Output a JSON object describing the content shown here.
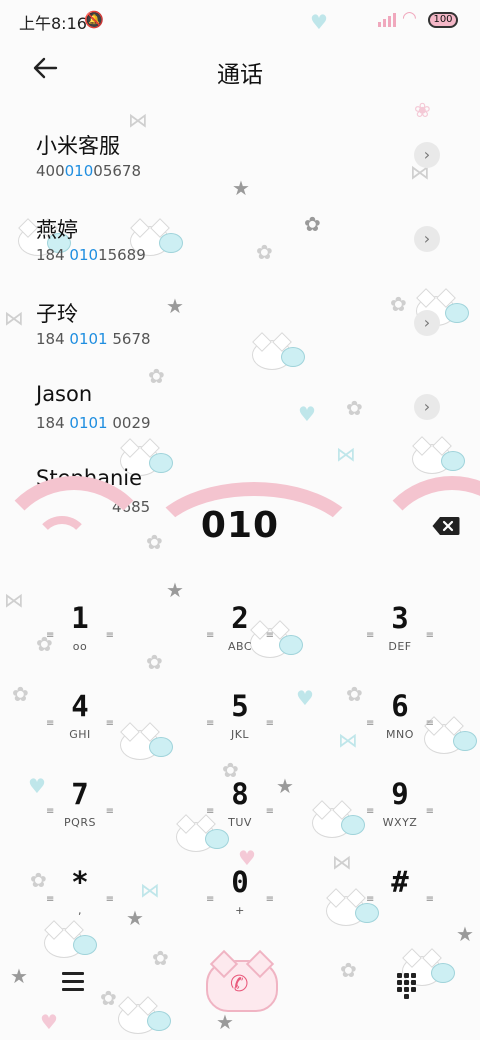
{
  "status_bar": {
    "time": "上午8:16",
    "battery": "100"
  },
  "header": {
    "title": "通话"
  },
  "contacts": [
    {
      "name": "小米客服",
      "num_pre": "400",
      "num_hl": "010",
      "num_post": "05678"
    },
    {
      "name": "燕婷",
      "num_pre": "184 ",
      "num_hl": "010",
      "num_post": "15689"
    },
    {
      "name": "子玲",
      "num_pre": "184 ",
      "num_hl": "0101",
      "num_post": " 5678"
    },
    {
      "name": "Jason",
      "num_pre": "184 ",
      "num_hl": "0101",
      "num_post": " 0029"
    },
    {
      "name": "Stephanie",
      "num_pre": "",
      "num_hl": "",
      "num_post": "4685"
    }
  ],
  "dialed_number": "010",
  "keypad": [
    {
      "digit": "1",
      "letters": "⌕"
    },
    {
      "digit": "2",
      "letters": "ABC"
    },
    {
      "digit": "3",
      "letters": "DEF"
    },
    {
      "digit": "4",
      "letters": "GHI"
    },
    {
      "digit": "5",
      "letters": "JKL"
    },
    {
      "digit": "6",
      "letters": "MNO"
    },
    {
      "digit": "7",
      "letters": "PQRS"
    },
    {
      "digit": "8",
      "letters": "TUV"
    },
    {
      "digit": "9",
      "letters": "WXYZ"
    },
    {
      "digit": "*",
      "letters": ","
    },
    {
      "digit": "0",
      "letters": "+"
    },
    {
      "digit": "#",
      "letters": ""
    }
  ],
  "colors": {
    "accent": "#1f8ee0",
    "theme_pink": "#f4c4cf",
    "call_icon": "#e95a7c"
  },
  "icons": [
    "mute-icon",
    "signal-icon",
    "wifi-icon",
    "battery-icon",
    "back-arrow-icon",
    "chevron-right-icon",
    "backspace-icon",
    "menu-icon",
    "call-icon",
    "dialpad-icon",
    "voicemail-icon"
  ]
}
